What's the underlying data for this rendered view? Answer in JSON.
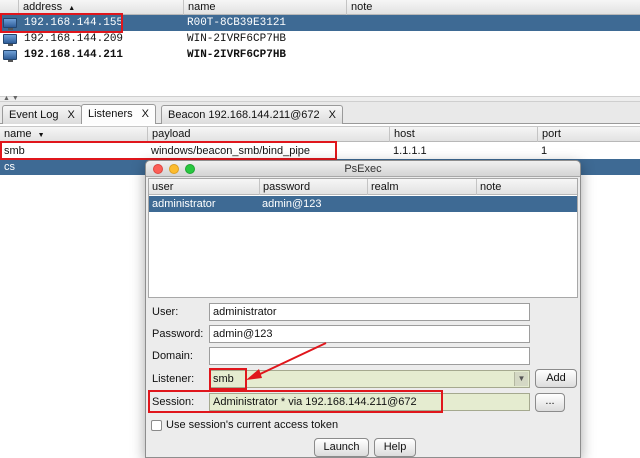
{
  "targets": {
    "columns": [
      "address",
      "name",
      "note"
    ],
    "rows": [
      {
        "address": "192.168.144.155",
        "name": "R00T-8CB39E3121",
        "note": ""
      },
      {
        "address": "192.168.144.209",
        "name": "WIN-2IVRF6CP7HB",
        "note": ""
      },
      {
        "address": "192.168.144.211",
        "name": "WIN-2IVRF6CP7HB",
        "note": ""
      }
    ],
    "sort_indicator": "▲"
  },
  "splitter": {
    "grip": "▲ ▼"
  },
  "tabs": [
    {
      "label": "Event Log",
      "close": "X"
    },
    {
      "label": "Listeners",
      "close": "X"
    },
    {
      "label": "Beacon 192.168.144.211@672",
      "close": "X"
    }
  ],
  "listeners": {
    "columns": [
      "name",
      "payload",
      "host",
      "port"
    ],
    "sort_indicator": "▼",
    "rows": [
      {
        "name": "smb",
        "payload": "windows/beacon_smb/bind_pipe",
        "host": "1.1.1.1",
        "port": "1"
      },
      {
        "name": "cs",
        "payload": "",
        "host": "",
        "port": ""
      }
    ]
  },
  "dialog": {
    "title": "PsExec",
    "cred_columns": [
      "user",
      "password",
      "realm",
      "note"
    ],
    "cred_rows": [
      {
        "user": "administrator",
        "password": "admin@123",
        "realm": "",
        "note": ""
      }
    ],
    "labels": {
      "user": "User:",
      "password": "Password:",
      "domain": "Domain:",
      "listener": "Listener:",
      "session": "Session:"
    },
    "values": {
      "user": "administrator",
      "password": "admin@123",
      "domain": "",
      "listener": "smb",
      "session": "Administrator * via  192.168.144.211@672"
    },
    "buttons": {
      "add": "Add",
      "browse": "...",
      "launch": "Launch",
      "help": "Help"
    },
    "checkbox_label": "Use session's current access token",
    "checkbox_checked": false
  },
  "colors": {
    "selection": "#3e6a94",
    "highlight_box": "#e0161c",
    "combo_fill": "#e5ecd0"
  }
}
